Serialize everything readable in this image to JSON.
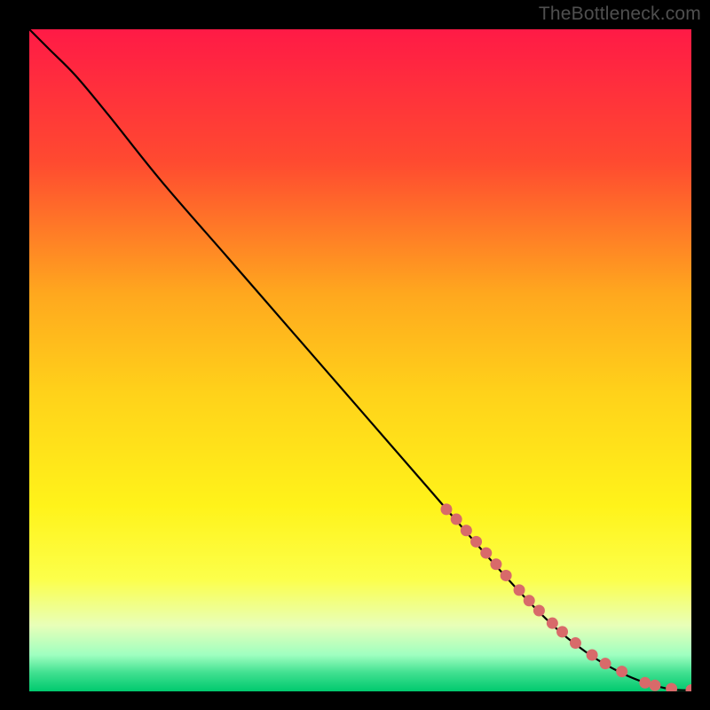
{
  "attribution": "TheBottleneck.com",
  "chart_data": {
    "type": "line",
    "title": "",
    "xlabel": "",
    "ylabel": "",
    "xlim": [
      0,
      100
    ],
    "ylim": [
      0,
      100
    ],
    "gradient_stops": [
      {
        "offset": 0.0,
        "color": "#ff1a46"
      },
      {
        "offset": 0.2,
        "color": "#ff4a30"
      },
      {
        "offset": 0.4,
        "color": "#ffa81e"
      },
      {
        "offset": 0.55,
        "color": "#ffd21a"
      },
      {
        "offset": 0.72,
        "color": "#fff31a"
      },
      {
        "offset": 0.83,
        "color": "#fcff4a"
      },
      {
        "offset": 0.9,
        "color": "#e8ffb8"
      },
      {
        "offset": 0.945,
        "color": "#9fffc0"
      },
      {
        "offset": 0.972,
        "color": "#40e090"
      },
      {
        "offset": 1.0,
        "color": "#00c96e"
      }
    ],
    "series": [
      {
        "name": "curve",
        "type": "line",
        "x": [
          0,
          3,
          7,
          12,
          20,
          30,
          40,
          50,
          60,
          70,
          78,
          84,
          89,
          93,
          96,
          98,
          100
        ],
        "y": [
          100,
          97,
          93,
          87,
          77,
          65.5,
          54,
          42.5,
          31,
          19.5,
          11,
          6,
          3,
          1.3,
          0.5,
          0.2,
          0.2
        ]
      },
      {
        "name": "highlight-points",
        "type": "scatter",
        "color": "#d86a6a",
        "radius": 6.5,
        "x": [
          63,
          64.5,
          66,
          67.5,
          69,
          70.5,
          72,
          74,
          75.5,
          77,
          79,
          80.5,
          82.5,
          85,
          87,
          89.5,
          93,
          94.5,
          97,
          100
        ],
        "y": [
          27.5,
          26,
          24.3,
          22.6,
          20.9,
          19.2,
          17.5,
          15.3,
          13.7,
          12.2,
          10.3,
          9,
          7.3,
          5.5,
          4.2,
          3,
          1.3,
          0.9,
          0.4,
          0.2
        ]
      }
    ]
  }
}
